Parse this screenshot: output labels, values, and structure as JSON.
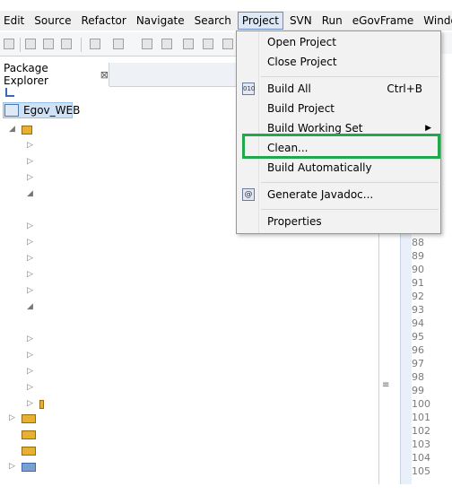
{
  "menubar": {
    "items": [
      "Edit",
      "Source",
      "Refactor",
      "Navigate",
      "Search",
      "Project",
      "SVN",
      "Run",
      "eGovFrame",
      "Windo"
    ]
  },
  "explorer": {
    "tab_label": "Package Explorer",
    "close_glyph": "⊠",
    "project_name": "Egov_WEB"
  },
  "project_menu": {
    "open_project": "Open Project",
    "close_project": "Close Project",
    "build_all": "Build All",
    "build_all_shortcut": "Ctrl+B",
    "build_project": "Build Project",
    "build_working_set": "Build Working Set",
    "clean": "Clean...",
    "build_automatically": "Build Automatically",
    "generate_javadoc": "Generate Javadoc...",
    "properties": "Properties",
    "icon_build_all": "010",
    "icon_javadoc": "@"
  },
  "editor": {
    "line_numbers": [
      "88",
      "89",
      "90",
      "91",
      "92",
      "93",
      "94",
      "95",
      "96",
      "97",
      "98",
      "99",
      "100",
      "101",
      "102",
      "103",
      "104",
      "105"
    ]
  },
  "colors": {
    "highlight": "#21a84a",
    "menu_active": "#dde8f6"
  }
}
